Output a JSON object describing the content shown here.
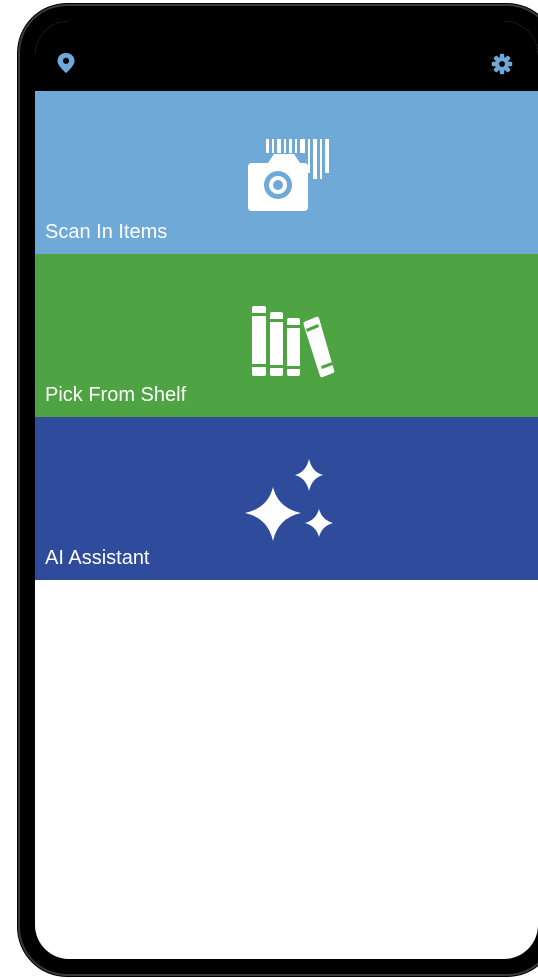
{
  "status_bar": {
    "left_icon": "location-pin-icon",
    "right_icon": "gear-icon"
  },
  "menu": {
    "items": [
      {
        "label": "Scan In Items",
        "icon": "barcode-camera-icon",
        "color": "#6fa9d8"
      },
      {
        "label": "Pick From Shelf",
        "icon": "books-icon",
        "color": "#4ea343"
      },
      {
        "label": "AI Assistant",
        "icon": "sparkles-icon",
        "color": "#2f4b9b"
      }
    ]
  }
}
